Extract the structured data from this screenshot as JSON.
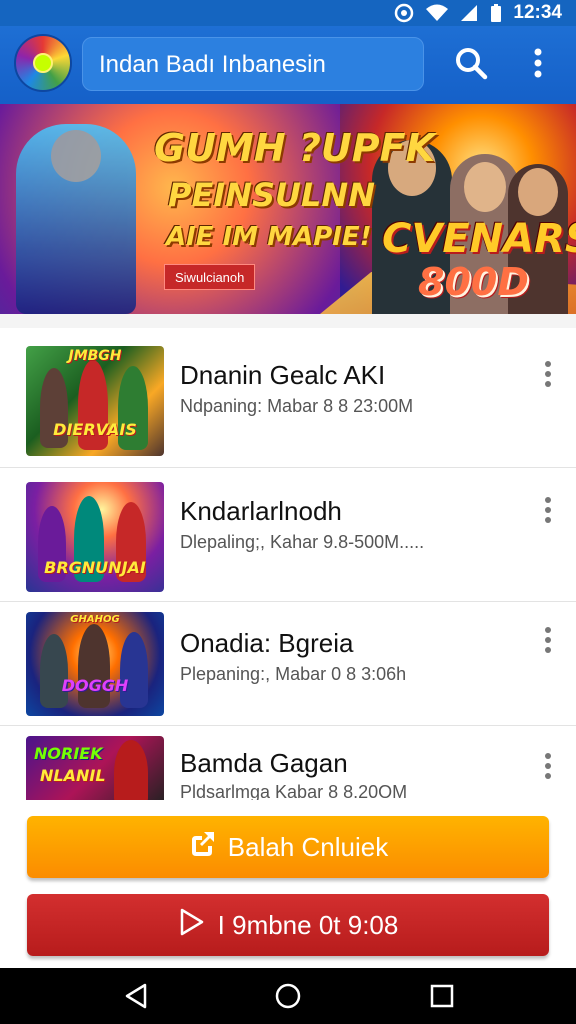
{
  "status_bar": {
    "time": "12:34",
    "icons": [
      "notification-icon",
      "wifi-icon",
      "signal-icon",
      "battery-icon"
    ]
  },
  "app_bar": {
    "logo_icon": "app-logo-icon",
    "search_text": "Indan Badı Inbanesin",
    "search_icon": "search-icon",
    "menu_icon": "more-vert-icon"
  },
  "banner": {
    "line1": "GUMH ?UPFK",
    "line2": "PEINSULNN",
    "line3": "AIE IM MAPIE!",
    "tag": "Siwulcianoh",
    "brand": "CVENARS",
    "brand_number": "800D"
  },
  "games": [
    {
      "thumb_caption_top": "JMBGH",
      "thumb_caption": "DIERVAIS",
      "title": "Dnanin Gealc AKI",
      "subtitle": "Ndpaning: Mabar 8 8 23:00M"
    },
    {
      "thumb_caption_top": "",
      "thumb_caption": "BRGNUNJAI",
      "title": "Kndarlarlnodh",
      "subtitle": "Dlepaling;, Kahar 9.8-500M....."
    },
    {
      "thumb_caption_top": "GHAHOG",
      "thumb_caption": "DOGGH",
      "title": "Onadia: Bgreia",
      "subtitle": "Plepaning:, Mabar 0 8 3:06h"
    },
    {
      "thumb_caption_top": "NORIEK",
      "thumb_caption": "NLANIL",
      "title": "Bamda Gagan",
      "subtitle": "Pldsarlmga Kabar 8 8.20OM"
    }
  ],
  "buttons": {
    "primary_label": "Balah Cnluiek",
    "primary_icon": "external-link-icon",
    "secondary_label": "I 9mbne 0t 9:08",
    "secondary_icon": "play-icon"
  },
  "nav_bar": {
    "icons": [
      "back-icon",
      "home-icon",
      "recents-icon"
    ]
  },
  "colors": {
    "primary": "#1565c0",
    "orange_button": "#fb8c00",
    "red_button": "#c62828"
  }
}
